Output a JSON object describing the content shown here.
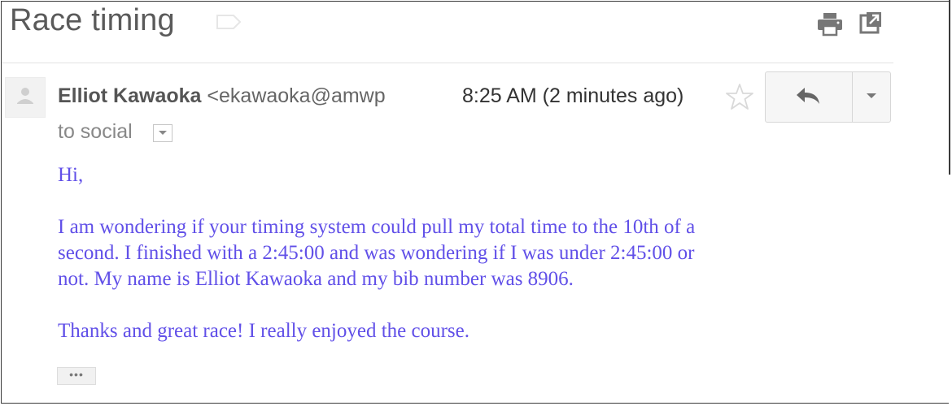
{
  "email": {
    "subject": "Race timing",
    "sender_name": "Elliot Kawaoka",
    "sender_email": "<ekawaoka@amwp",
    "time": "8:25 AM (2 minutes ago)",
    "to_line": "to social",
    "body": {
      "greeting": "Hi,",
      "paragraph1_line1": "I am wondering if your timing system could pull my total time to the 10th of a",
      "paragraph1_line2": "second.  I finished with a 2:45:00 and was wondering if I was under 2:45:00 or",
      "paragraph1_line3": "not. My name is Elliot Kawaoka and my bib number was 8906.",
      "paragraph2": "Thanks and great race! I really enjoyed the course."
    },
    "trimmed_content_label": "•••"
  },
  "colors": {
    "body_text": "#6150e8",
    "subject": "#5a5a5a"
  },
  "icons": [
    "label-icon",
    "print-icon",
    "popout-icon",
    "avatar-icon",
    "star-icon",
    "reply-icon",
    "chevron-down-icon"
  ]
}
